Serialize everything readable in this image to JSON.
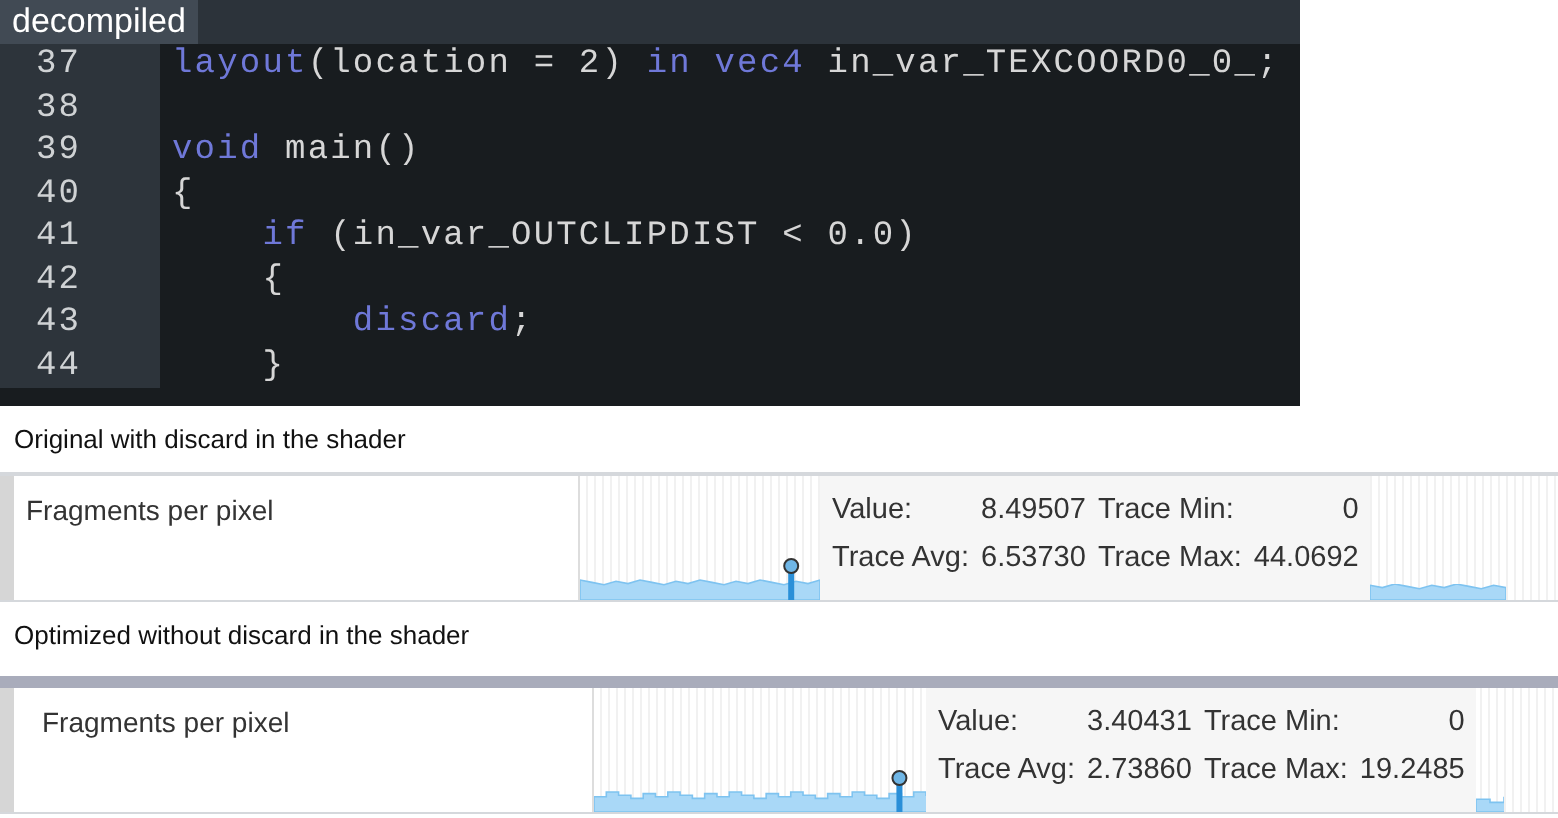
{
  "editor": {
    "tab": {
      "label": "decompiled",
      "selected": true
    },
    "lines": [
      {
        "number": "37",
        "tokens": [
          {
            "text": "layout",
            "kind": "keyword"
          },
          {
            "text": "(location = 2) ",
            "kind": "plain"
          },
          {
            "text": "in",
            "kind": "keyword"
          },
          {
            "text": " vec4",
            "kind": "keyword"
          },
          {
            "text": " in_var_TEXCOORD0_0_;",
            "kind": "plain"
          }
        ]
      },
      {
        "number": "38"
      },
      {
        "number": "39",
        "tokens": [
          {
            "text": "void",
            "kind": "keyword"
          },
          {
            "text": " main()",
            "kind": "plain"
          }
        ]
      },
      {
        "number": "40",
        "tokens": [
          {
            "text": "{",
            "kind": "plain"
          }
        ]
      },
      {
        "number": "41",
        "tokens": [
          {
            "text": "    if",
            "kind": "keyword"
          },
          {
            "text": " (in_var_OUTCLIPDIST < 0.0)",
            "kind": "plain"
          }
        ]
      },
      {
        "number": "42",
        "tokens": [
          {
            "text": "    {",
            "kind": "plain"
          }
        ]
      },
      {
        "number": "43",
        "tokens": [
          {
            "text": "        discard",
            "kind": "keyword"
          },
          {
            "text": ";",
            "kind": "plain"
          }
        ]
      },
      {
        "number": "44",
        "tokens": [
          {
            "text": "    }",
            "kind": "plain"
          }
        ]
      }
    ]
  },
  "comparisons": [
    {
      "caption": "Original with discard in the shader",
      "metric": "Fragments per pixel",
      "stats": [
        {
          "label": "Value:",
          "value": "8.49507"
        },
        {
          "label": "Trace Min:",
          "value": "0"
        },
        {
          "label": "Trace Avg:",
          "value": "6.53730"
        },
        {
          "label": "Trace Max:",
          "value": "44.0692"
        }
      ]
    },
    {
      "caption": "Optimized without discard in the shader",
      "metric": "Fragments per pixel",
      "stats": [
        {
          "label": "Value:",
          "value": "3.40431"
        },
        {
          "label": "Trace Min:",
          "value": "0"
        },
        {
          "label": "Trace Avg:",
          "value": "2.73860"
        },
        {
          "label": "Trace Max:",
          "value": "19.2485"
        }
      ]
    }
  ]
}
